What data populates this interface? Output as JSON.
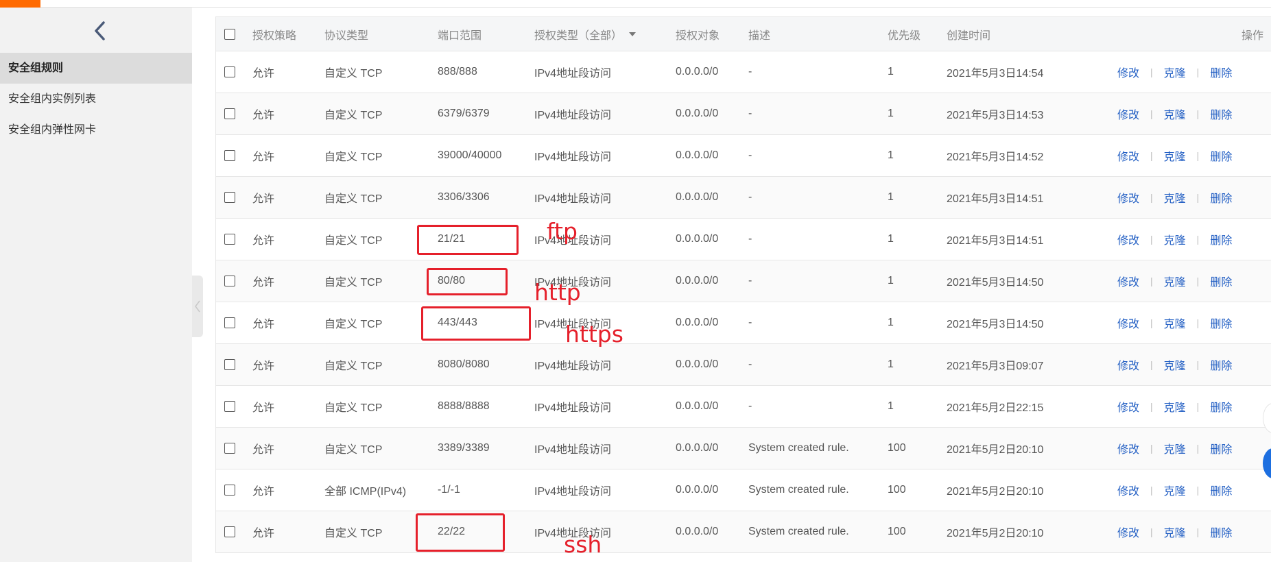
{
  "sidebar": {
    "items": [
      {
        "label": "安全组规则",
        "active": true
      },
      {
        "label": "安全组内实例列表",
        "active": false
      },
      {
        "label": "安全组内弹性网卡",
        "active": false
      }
    ]
  },
  "table": {
    "headers": {
      "policy": "授权策略",
      "protocol": "协议类型",
      "port": "端口范围",
      "auth_type": "授权类型（全部）",
      "auth_object": "授权对象",
      "description": "描述",
      "priority": "优先级",
      "created": "创建时间",
      "actions": "操作"
    },
    "action_labels": {
      "edit": "修改",
      "clone": "克隆",
      "delete": "删除"
    },
    "rows": [
      {
        "policy": "允许",
        "protocol": "自定义 TCP",
        "port": "888/888",
        "auth_type": "IPv4地址段访问",
        "auth_object": "0.0.0.0/0",
        "description": "-",
        "priority": "1",
        "created": "2021年5月3日14:54"
      },
      {
        "policy": "允许",
        "protocol": "自定义 TCP",
        "port": "6379/6379",
        "auth_type": "IPv4地址段访问",
        "auth_object": "0.0.0.0/0",
        "description": "-",
        "priority": "1",
        "created": "2021年5月3日14:53"
      },
      {
        "policy": "允许",
        "protocol": "自定义 TCP",
        "port": "39000/40000",
        "auth_type": "IPv4地址段访问",
        "auth_object": "0.0.0.0/0",
        "description": "-",
        "priority": "1",
        "created": "2021年5月3日14:52"
      },
      {
        "policy": "允许",
        "protocol": "自定义 TCP",
        "port": "3306/3306",
        "auth_type": "IPv4地址段访问",
        "auth_object": "0.0.0.0/0",
        "description": "-",
        "priority": "1",
        "created": "2021年5月3日14:51"
      },
      {
        "policy": "允许",
        "protocol": "自定义 TCP",
        "port": "21/21",
        "auth_type": "IPv4地址段访问",
        "auth_object": "0.0.0.0/0",
        "description": "-",
        "priority": "1",
        "created": "2021年5月3日14:51"
      },
      {
        "policy": "允许",
        "protocol": "自定义 TCP",
        "port": "80/80",
        "auth_type": "IPv4地址段访问",
        "auth_object": "0.0.0.0/0",
        "description": "-",
        "priority": "1",
        "created": "2021年5月3日14:50"
      },
      {
        "policy": "允许",
        "protocol": "自定义 TCP",
        "port": "443/443",
        "auth_type": "IPv4地址段访问",
        "auth_object": "0.0.0.0/0",
        "description": "-",
        "priority": "1",
        "created": "2021年5月3日14:50"
      },
      {
        "policy": "允许",
        "protocol": "自定义 TCP",
        "port": "8080/8080",
        "auth_type": "IPv4地址段访问",
        "auth_object": "0.0.0.0/0",
        "description": "-",
        "priority": "1",
        "created": "2021年5月3日09:07"
      },
      {
        "policy": "允许",
        "protocol": "自定义 TCP",
        "port": "8888/8888",
        "auth_type": "IPv4地址段访问",
        "auth_object": "0.0.0.0/0",
        "description": "-",
        "priority": "1",
        "created": "2021年5月2日22:15"
      },
      {
        "policy": "允许",
        "protocol": "自定义 TCP",
        "port": "3389/3389",
        "auth_type": "IPv4地址段访问",
        "auth_object": "0.0.0.0/0",
        "description": "System created rule.",
        "priority": "100",
        "created": "2021年5月2日20:10"
      },
      {
        "policy": "允许",
        "protocol": "全部 ICMP(IPv4)",
        "port": "-1/-1",
        "auth_type": "IPv4地址段访问",
        "auth_object": "0.0.0.0/0",
        "description": "System created rule.",
        "priority": "100",
        "created": "2021年5月2日20:10"
      },
      {
        "policy": "允许",
        "protocol": "自定义 TCP",
        "port": "22/22",
        "auth_type": "IPv4地址段访问",
        "auth_object": "0.0.0.0/0",
        "description": "System created rule.",
        "priority": "100",
        "created": "2021年5月2日20:10"
      }
    ]
  },
  "annotations": [
    {
      "label": "ftp",
      "row": 4
    },
    {
      "label": "http",
      "row": 5
    },
    {
      "label": "https",
      "row": 6
    },
    {
      "label": "ssh",
      "row": 11
    }
  ],
  "colors": {
    "accent": "#ff6a00",
    "link": "#2460c4",
    "annotation": "#e5202b"
  }
}
